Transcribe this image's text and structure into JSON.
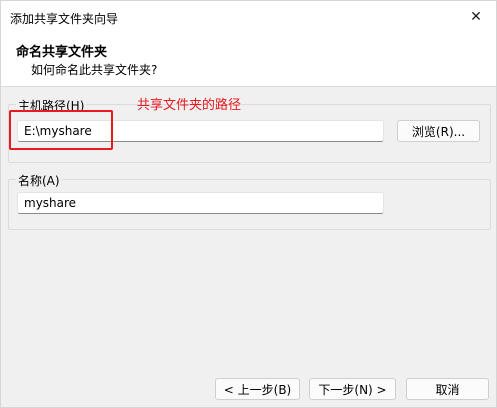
{
  "window": {
    "title": "添加共享文件夹向导",
    "close_glyph": "✕"
  },
  "header": {
    "title": "命名共享文件夹",
    "subtitle": "如何命名此共享文件夹?"
  },
  "host_path": {
    "label": "主机路径(H)",
    "value": "E:\\myshare",
    "browse_label": "浏览(R)..."
  },
  "name_group": {
    "label": "名称(A)",
    "value": "myshare"
  },
  "annotation": {
    "text": "共享文件夹的路径",
    "color": "#e8191f"
  },
  "footer": {
    "back_label": "< 上一步(B)",
    "next_label": "下一步(N) >",
    "cancel_label": "取消"
  }
}
